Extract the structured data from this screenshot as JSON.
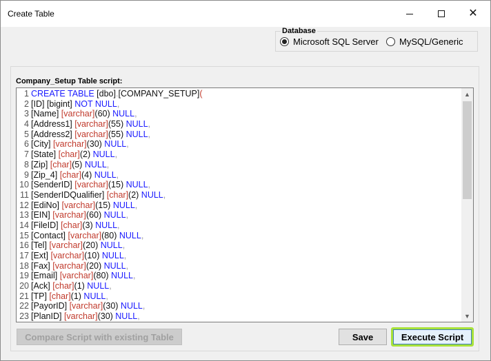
{
  "window": {
    "title": "Create Table",
    "controls": {
      "minimize": "minimize-icon",
      "maximize": "maximize-icon",
      "close": "close-icon"
    }
  },
  "database": {
    "label": "Database",
    "options": [
      {
        "label": "Microsoft SQL Server",
        "selected": true
      },
      {
        "label": "MySQL/Generic",
        "selected": false
      }
    ]
  },
  "script": {
    "label": "Company_Setup Table script:",
    "lines": [
      {
        "n": "1",
        "tokens": [
          [
            "kw",
            "CREATE TABLE "
          ],
          [
            "id",
            "[dbo]"
          ],
          [
            "pn",
            "."
          ],
          [
            "id",
            "[COMPANY_SETUP]"
          ],
          [
            "ty",
            "("
          ]
        ]
      },
      {
        "n": "2",
        "tokens": [
          [
            "id",
            "[ID] "
          ],
          [
            "id",
            "[bigint] "
          ],
          [
            "kw",
            "NOT NULL"
          ],
          [
            "pn",
            ","
          ]
        ]
      },
      {
        "n": "3",
        "tokens": [
          [
            "id",
            "[Name] "
          ],
          [
            "ty",
            "[varchar]"
          ],
          [
            "id",
            "(60) "
          ],
          [
            "kw",
            "NULL"
          ],
          [
            "pn",
            ","
          ]
        ]
      },
      {
        "n": "4",
        "tokens": [
          [
            "id",
            "[Address1] "
          ],
          [
            "ty",
            "[varchar]"
          ],
          [
            "id",
            "(55) "
          ],
          [
            "kw",
            "NULL"
          ],
          [
            "pn",
            ","
          ]
        ]
      },
      {
        "n": "5",
        "tokens": [
          [
            "id",
            "[Address2] "
          ],
          [
            "ty",
            "[varchar]"
          ],
          [
            "id",
            "(55) "
          ],
          [
            "kw",
            "NULL"
          ],
          [
            "pn",
            ","
          ]
        ]
      },
      {
        "n": "6",
        "tokens": [
          [
            "id",
            "[City] "
          ],
          [
            "ty",
            "[varchar]"
          ],
          [
            "id",
            "(30) "
          ],
          [
            "kw",
            "NULL"
          ],
          [
            "pn",
            ","
          ]
        ]
      },
      {
        "n": "7",
        "tokens": [
          [
            "id",
            "[State] "
          ],
          [
            "ty",
            "[char]"
          ],
          [
            "id",
            "(2) "
          ],
          [
            "kw",
            "NULL"
          ],
          [
            "pn",
            ","
          ]
        ]
      },
      {
        "n": "8",
        "tokens": [
          [
            "id",
            "[Zip] "
          ],
          [
            "ty",
            "[char]"
          ],
          [
            "id",
            "(5) "
          ],
          [
            "kw",
            "NULL"
          ],
          [
            "pn",
            ","
          ]
        ]
      },
      {
        "n": "9",
        "tokens": [
          [
            "id",
            "[Zip_4] "
          ],
          [
            "ty",
            "[char]"
          ],
          [
            "id",
            "(4) "
          ],
          [
            "kw",
            "NULL"
          ],
          [
            "pn",
            ","
          ]
        ]
      },
      {
        "n": "10",
        "tokens": [
          [
            "id",
            "[SenderID] "
          ],
          [
            "ty",
            "[varchar]"
          ],
          [
            "id",
            "(15) "
          ],
          [
            "kw",
            "NULL"
          ],
          [
            "pn",
            ","
          ]
        ]
      },
      {
        "n": "11",
        "tokens": [
          [
            "id",
            "[SenderIDQualifier] "
          ],
          [
            "ty",
            "[char]"
          ],
          [
            "id",
            "(2) "
          ],
          [
            "kw",
            "NULL"
          ],
          [
            "pn",
            ","
          ]
        ]
      },
      {
        "n": "12",
        "tokens": [
          [
            "id",
            "[EdiNo] "
          ],
          [
            "ty",
            "[varchar]"
          ],
          [
            "id",
            "(15) "
          ],
          [
            "kw",
            "NULL"
          ],
          [
            "pn",
            ","
          ]
        ]
      },
      {
        "n": "13",
        "tokens": [
          [
            "id",
            "[EIN] "
          ],
          [
            "ty",
            "[varchar]"
          ],
          [
            "id",
            "(60) "
          ],
          [
            "kw",
            "NULL"
          ],
          [
            "pn",
            ","
          ]
        ]
      },
      {
        "n": "14",
        "tokens": [
          [
            "id",
            "[FileID] "
          ],
          [
            "ty",
            "[char]"
          ],
          [
            "id",
            "(3) "
          ],
          [
            "kw",
            "NULL"
          ],
          [
            "pn",
            ","
          ]
        ]
      },
      {
        "n": "15",
        "tokens": [
          [
            "id",
            "[Contact] "
          ],
          [
            "ty",
            "[varchar]"
          ],
          [
            "id",
            "(80) "
          ],
          [
            "kw",
            "NULL"
          ],
          [
            "pn",
            ","
          ]
        ]
      },
      {
        "n": "16",
        "tokens": [
          [
            "id",
            "[Tel] "
          ],
          [
            "ty",
            "[varchar]"
          ],
          [
            "id",
            "(20) "
          ],
          [
            "kw",
            "NULL"
          ],
          [
            "pn",
            ","
          ]
        ]
      },
      {
        "n": "17",
        "tokens": [
          [
            "id",
            "[Ext] "
          ],
          [
            "ty",
            "[varchar]"
          ],
          [
            "id",
            "(10) "
          ],
          [
            "kw",
            "NULL"
          ],
          [
            "pn",
            ","
          ]
        ]
      },
      {
        "n": "18",
        "tokens": [
          [
            "id",
            "[Fax] "
          ],
          [
            "ty",
            "[varchar]"
          ],
          [
            "id",
            "(20) "
          ],
          [
            "kw",
            "NULL"
          ],
          [
            "pn",
            ","
          ]
        ]
      },
      {
        "n": "19",
        "tokens": [
          [
            "id",
            "[Email] "
          ],
          [
            "ty",
            "[varchar]"
          ],
          [
            "id",
            "(80) "
          ],
          [
            "kw",
            "NULL"
          ],
          [
            "pn",
            ","
          ]
        ]
      },
      {
        "n": "20",
        "tokens": [
          [
            "id",
            "[Ack] "
          ],
          [
            "ty",
            "[char]"
          ],
          [
            "id",
            "(1) "
          ],
          [
            "kw",
            "NULL"
          ],
          [
            "pn",
            ","
          ]
        ]
      },
      {
        "n": "21",
        "tokens": [
          [
            "id",
            "[TP] "
          ],
          [
            "ty",
            "[char]"
          ],
          [
            "id",
            "(1) "
          ],
          [
            "kw",
            "NULL"
          ],
          [
            "pn",
            ","
          ]
        ]
      },
      {
        "n": "22",
        "tokens": [
          [
            "id",
            "[PayorID] "
          ],
          [
            "ty",
            "[varchar]"
          ],
          [
            "id",
            "(30) "
          ],
          [
            "kw",
            "NULL"
          ],
          [
            "pn",
            ","
          ]
        ]
      },
      {
        "n": "23",
        "tokens": [
          [
            "id",
            "[PlanID] "
          ],
          [
            "ty",
            "[varchar]"
          ],
          [
            "id",
            "(30) "
          ],
          [
            "kw",
            "NULL"
          ],
          [
            "pn",
            ","
          ]
        ]
      }
    ]
  },
  "buttons": {
    "compare": "Compare Script with existing Table",
    "save": "Save",
    "execute": "Execute Script"
  },
  "colors": {
    "keyword": "#1a1aff",
    "type": "#c0392b",
    "highlight": "#a8e23a"
  }
}
